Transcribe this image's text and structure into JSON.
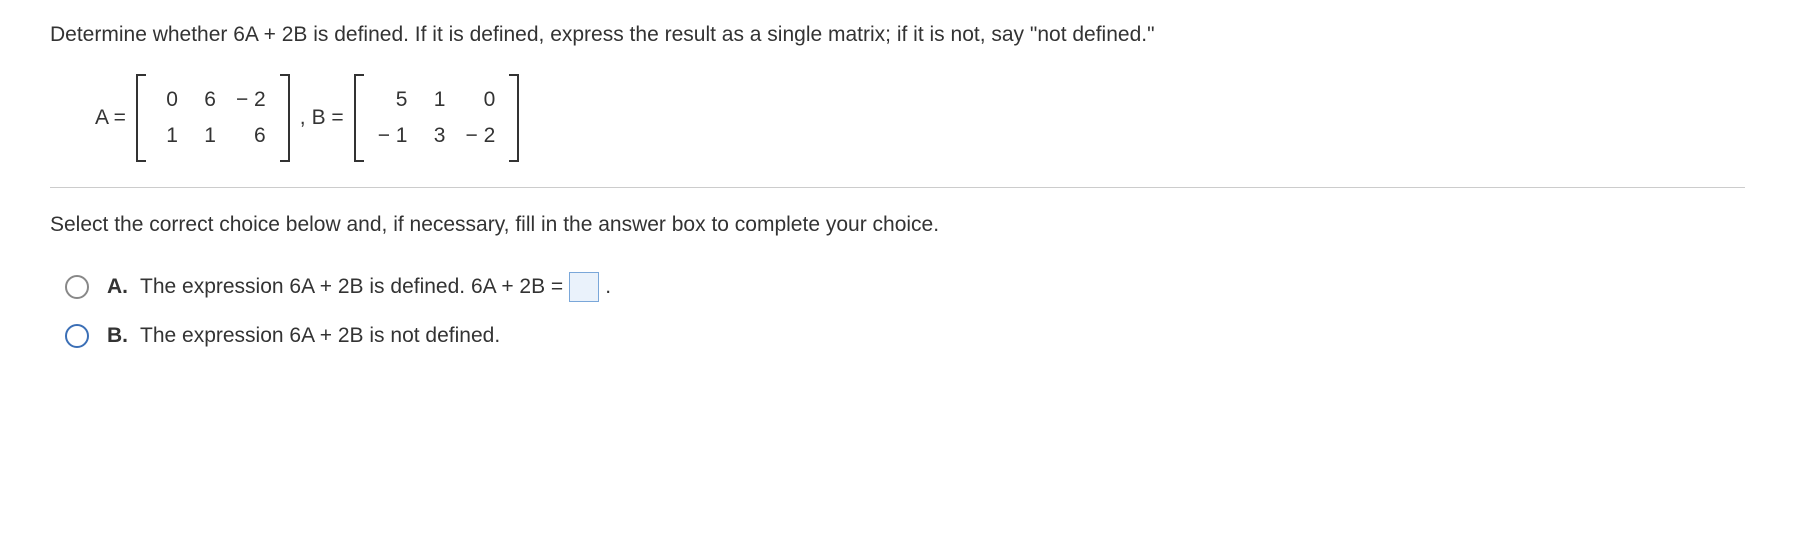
{
  "question": "Determine whether 6A + 2B is defined. If it is defined, express the result as a single matrix; if it is not, say \"not defined.\"",
  "matrixA": {
    "label": "A =",
    "rows": [
      [
        "0",
        "6",
        "− 2"
      ],
      [
        "1",
        "1",
        "6"
      ]
    ]
  },
  "separator": ",",
  "matrixB": {
    "label": "B =",
    "rows": [
      [
        "5",
        "1",
        "0"
      ],
      [
        "− 1",
        "3",
        "− 2"
      ]
    ]
  },
  "instruction": "Select the correct choice below and, if necessary, fill in the answer box to complete your choice.",
  "choices": {
    "A": {
      "letter": "A.",
      "text_before": "The expression 6A + 2B is defined. 6A + 2B =",
      "text_after": "."
    },
    "B": {
      "letter": "B.",
      "text": "The expression 6A + 2B is not defined."
    }
  }
}
